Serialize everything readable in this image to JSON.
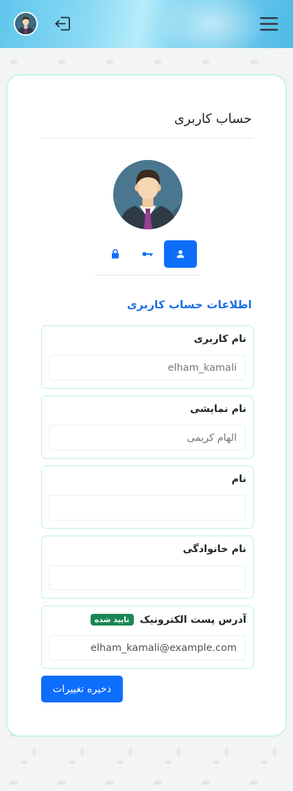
{
  "header": {
    "avatar_icon": "user-avatar-icon",
    "logout_icon": "logout-icon",
    "menu_icon": "hamburger-menu-icon"
  },
  "card": {
    "title": "حساب کاربری",
    "tabs": [
      {
        "icon": "lock-icon",
        "active": false
      },
      {
        "icon": "key-icon",
        "active": false
      },
      {
        "icon": "user-icon",
        "active": true
      }
    ],
    "section_title": "اطلاعات حساب کاربری",
    "fields": {
      "username": {
        "label": "نام کاربری",
        "placeholder": "elham_kamali",
        "value": ""
      },
      "display_name": {
        "label": "نام نمایشی",
        "placeholder": "الهام کریمی",
        "value": ""
      },
      "first_name": {
        "label": "نام",
        "value": ""
      },
      "last_name": {
        "label": "نام خانوادگی",
        "value": ""
      },
      "email": {
        "label": "آدرس پست الکترونیک",
        "badge": "تایید شده",
        "value": "elham_kamali@example.com"
      }
    },
    "save_label": "ذخیره تغییرات"
  },
  "colors": {
    "accent": "#0d6efd",
    "section_title": "#1c6fe4",
    "verified_badge": "#198754",
    "card_border": "#c6f2ec"
  }
}
